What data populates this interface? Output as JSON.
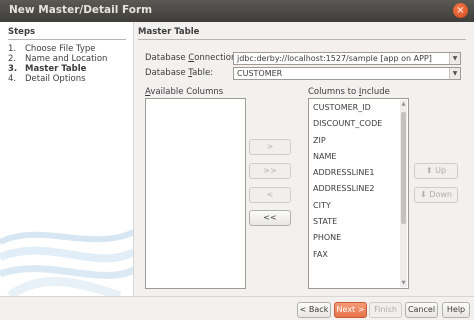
{
  "window": {
    "title": "New Master/Detail Form",
    "close_glyph": "×"
  },
  "steps": {
    "header": "Steps",
    "items": [
      {
        "num": "1.",
        "label": "Choose File Type"
      },
      {
        "num": "2.",
        "label": "Name and Location"
      },
      {
        "num": "3.",
        "label": "Master Table"
      },
      {
        "num": "4.",
        "label": "Detail Options"
      }
    ],
    "current_index": 2
  },
  "panel": {
    "header": "Master Table",
    "connection": {
      "label_pre": "Database ",
      "label_u": "C",
      "label_post": "onnection:",
      "value": "jdbc:derby://localhost:1527/sample [app on APP]"
    },
    "table": {
      "label_pre": "Database ",
      "label_u": "T",
      "label_post": "able:",
      "value": "CUSTOMER"
    },
    "available": {
      "label_u": "A",
      "label_rest": "vailable Columns",
      "items": []
    },
    "included": {
      "label_pre": "Columns to ",
      "label_u": "I",
      "label_post": "nclude",
      "items": [
        "CUSTOMER_ID",
        "DISCOUNT_CODE",
        "ZIP",
        "NAME",
        "ADDRESSLINE1",
        "ADDRESSLINE2",
        "CITY",
        "STATE",
        "PHONE",
        "FAX"
      ]
    },
    "transfer": {
      "add": ">",
      "add_all": ">>",
      "remove": "<",
      "remove_all": "<<"
    },
    "order": {
      "up": "Up",
      "down": "Down",
      "up_glyph": "⬆",
      "down_glyph": "⬇"
    }
  },
  "buttons": {
    "back": "< Back",
    "next": "Next >",
    "finish": "Finish",
    "cancel": "Cancel",
    "help": "Help"
  },
  "colors": {
    "primary": "#e7734b",
    "titlebar": "#3e3d39"
  }
}
